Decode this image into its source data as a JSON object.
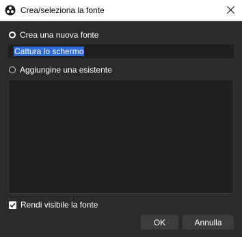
{
  "window": {
    "title": "Crea/seleziona la fonte",
    "app_icon": "obs-icon",
    "close_icon": "close-icon"
  },
  "options": {
    "create_new": {
      "label": "Crea una nuova fonte",
      "selected": true
    },
    "add_existing": {
      "label": "Aggiungine una esistente",
      "selected": false
    }
  },
  "name_field": {
    "value": "Cattura lo schermo"
  },
  "visible_checkbox": {
    "label": "Rendi visibile la fonte",
    "checked": true
  },
  "buttons": {
    "ok": "OK",
    "cancel": "Annulla"
  },
  "colors": {
    "background": "#2b2b2b",
    "field": "#1f1f1f",
    "selection": "#2f6bd9",
    "button": "#3c3c3c"
  }
}
